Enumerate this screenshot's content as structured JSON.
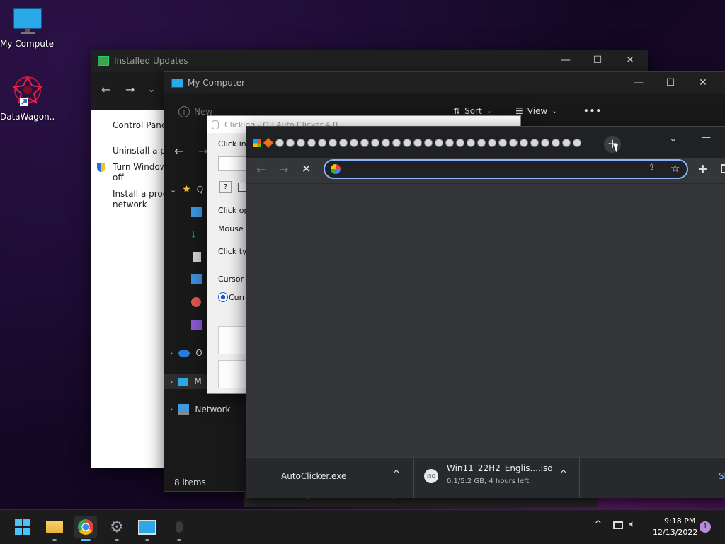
{
  "desktop": {
    "icons": [
      {
        "label": "My Computer",
        "icon": "monitor-icon"
      },
      {
        "label": "DataWagon...",
        "icon": "datawagon-shortcut-icon"
      }
    ]
  },
  "installed_updates": {
    "title": "Installed Updates",
    "links": [
      "Control Panel",
      "Uninstall a pro",
      "Turn Windows",
      "off",
      "Install a progr",
      "network"
    ]
  },
  "explorer": {
    "title": "My Computer",
    "toolbar": {
      "new": "New",
      "sort": "Sort",
      "view": "View",
      "more": "•••"
    },
    "sidebar": {
      "quick_access": "Q",
      "onedrive": "O",
      "this_pc": "M",
      "network": "Network"
    },
    "status": {
      "items": "8 items"
    }
  },
  "autoclicker": {
    "title": "Clicking - OP Auto Clicker 4.0",
    "labels": {
      "click_interval": "Click inte",
      "help": "?",
      "click_options": "Click opt",
      "mouse_button": "Mouse b",
      "click_type": "Click typ",
      "cursor_position": "Cursor p",
      "current": "Curre"
    }
  },
  "chrome": {
    "omnibox": {
      "value": "",
      "placeholder": ""
    },
    "downloads": [
      {
        "name": "AutoClicker.exe",
        "status": ""
      },
      {
        "name": "Win11_22H2_Englis....iso",
        "status": "0.1/5.2 GB, 4 hours left",
        "badge": "ISO"
      }
    ],
    "show_all": "Sh"
  },
  "background_window_text": {
    "text": "based Systems (KB5012170)"
  },
  "taskbar": {
    "time": "9:18 PM",
    "date": "12/13/2022",
    "notification_count": "1"
  }
}
